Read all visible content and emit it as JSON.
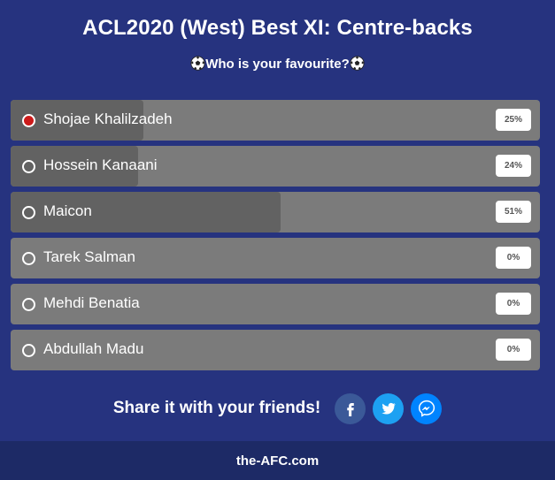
{
  "poll": {
    "title": "ACL2020 (West) Best XI: Centre-backs",
    "subtitle": "Who is your favourite?",
    "subtitle_icon": "soccer-ball-icon",
    "options": [
      {
        "label": "Shojae Khalilzadeh",
        "percent_text": "25%",
        "share": 0.25,
        "selected": true
      },
      {
        "label": "Hossein Kanaani",
        "percent_text": "24%",
        "share": 0.24,
        "selected": false
      },
      {
        "label": "Maicon",
        "percent_text": "51%",
        "share": 0.51,
        "selected": false
      },
      {
        "label": "Tarek Salman",
        "percent_text": "0%",
        "share": 0,
        "selected": false
      },
      {
        "label": "Mehdi Benatia",
        "percent_text": "0%",
        "share": 0,
        "selected": false
      },
      {
        "label": "Abdullah Madu",
        "percent_text": "0%",
        "share": 0,
        "selected": false
      }
    ]
  },
  "share": {
    "label": "Share it with your friends!",
    "buttons": [
      {
        "icon": "facebook-icon",
        "color": "#3b5998"
      },
      {
        "icon": "twitter-icon",
        "color": "#1da1f2"
      },
      {
        "icon": "messenger-icon",
        "color": "#0084ff"
      }
    ]
  },
  "footer": {
    "site": "the-AFC.com"
  },
  "colors": {
    "background": "#26337f",
    "footer": "#1d2a66",
    "option_bg": "#7b7b7b",
    "option_fill": "#626262",
    "selected_radio": "#cc1b1b"
  }
}
